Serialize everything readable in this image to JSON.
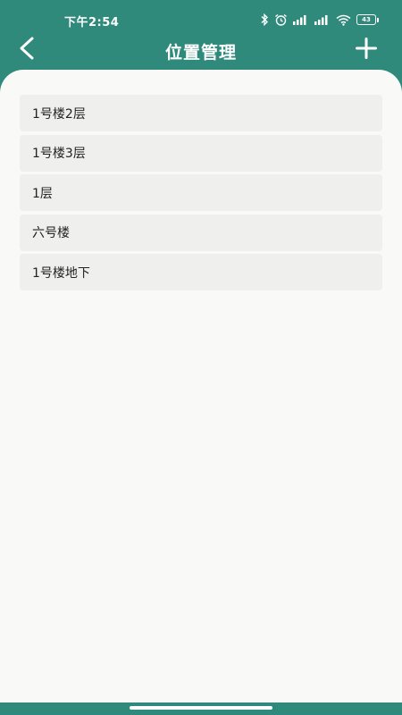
{
  "status_bar": {
    "time": "下午2:54",
    "battery": "43",
    "icons": [
      "bluetooth-icon",
      "alarm-icon",
      "signal-icon",
      "signal-icon",
      "wifi-icon",
      "battery-icon"
    ]
  },
  "header": {
    "title": "位置管理",
    "back_icon": "chevron-left-icon",
    "add_icon": "plus-icon"
  },
  "locations": [
    {
      "label": "1号楼2层"
    },
    {
      "label": "1号楼3层"
    },
    {
      "label": "1层"
    },
    {
      "label": "六号楼"
    },
    {
      "label": "1号楼地下"
    }
  ],
  "colors": {
    "primary": "#2f8a7b",
    "content_bg": "#f9f9f8",
    "item_bg": "#efefee",
    "text": "#222222"
  }
}
